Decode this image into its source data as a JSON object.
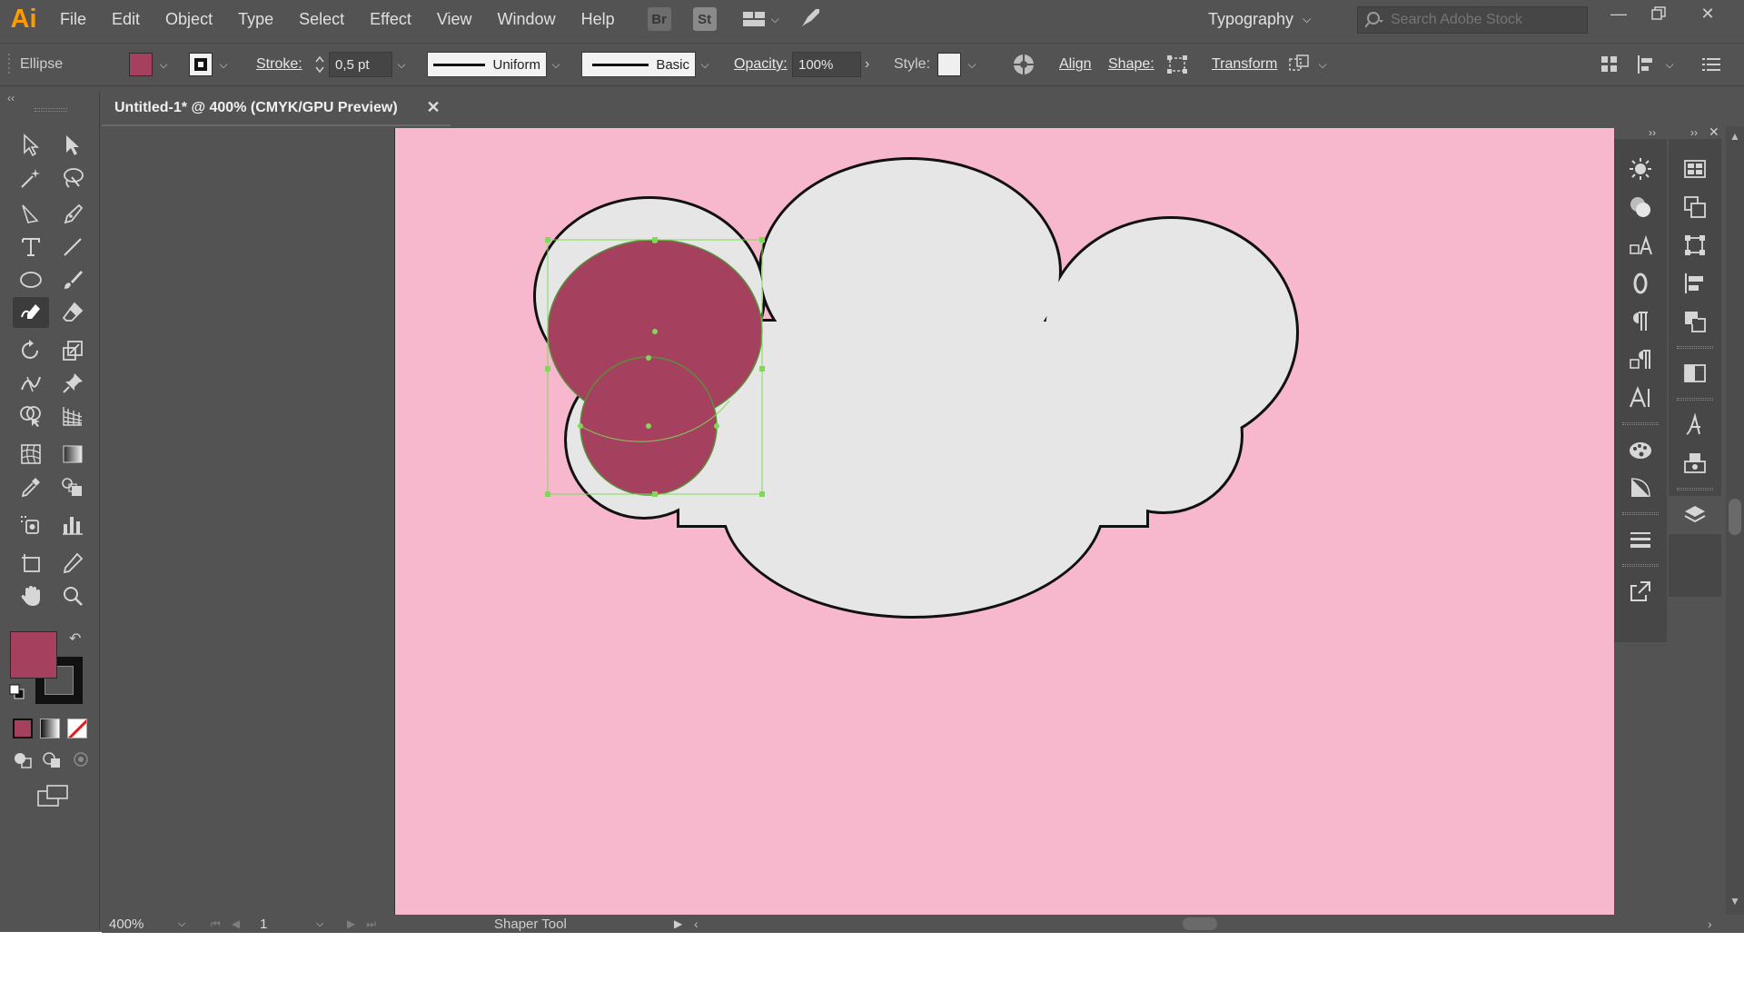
{
  "menubar": {
    "logo": "Ai",
    "items": [
      "File",
      "Edit",
      "Object",
      "Type",
      "Select",
      "Effect",
      "View",
      "Window",
      "Help"
    ],
    "bridge_label": "Br",
    "stock_label": "St",
    "workspace": "Typography",
    "search_placeholder": "Search Adobe Stock"
  },
  "controlbar": {
    "selection_type": "Ellipse",
    "fill_color": "#a5405f",
    "stroke_label": "Stroke:",
    "stroke_weight": "0,5 pt",
    "profile_label": "Uniform",
    "brush_label": "Basic",
    "opacity_label": "Opacity:",
    "opacity_value": "100%",
    "style_label": "Style:",
    "align_label": "Align",
    "shape_label": "Shape:",
    "transform_label": "Transform"
  },
  "document": {
    "tab_title": "Untitled-1* @ 400% (CMYK/GPU Preview)"
  },
  "colors": {
    "artboard": "#f7b8cd",
    "cloud_fill": "#e6e6e6",
    "circle_fill": "#a5405f",
    "selection": "#7ed957",
    "ui_dark": "#535353"
  },
  "toolbar": {
    "active_tool": "shaper-tool",
    "fill_swatch": "#a5405f"
  },
  "statusbar": {
    "zoom": "400%",
    "artboard_number": "1",
    "current_tool": "Shaper Tool"
  }
}
